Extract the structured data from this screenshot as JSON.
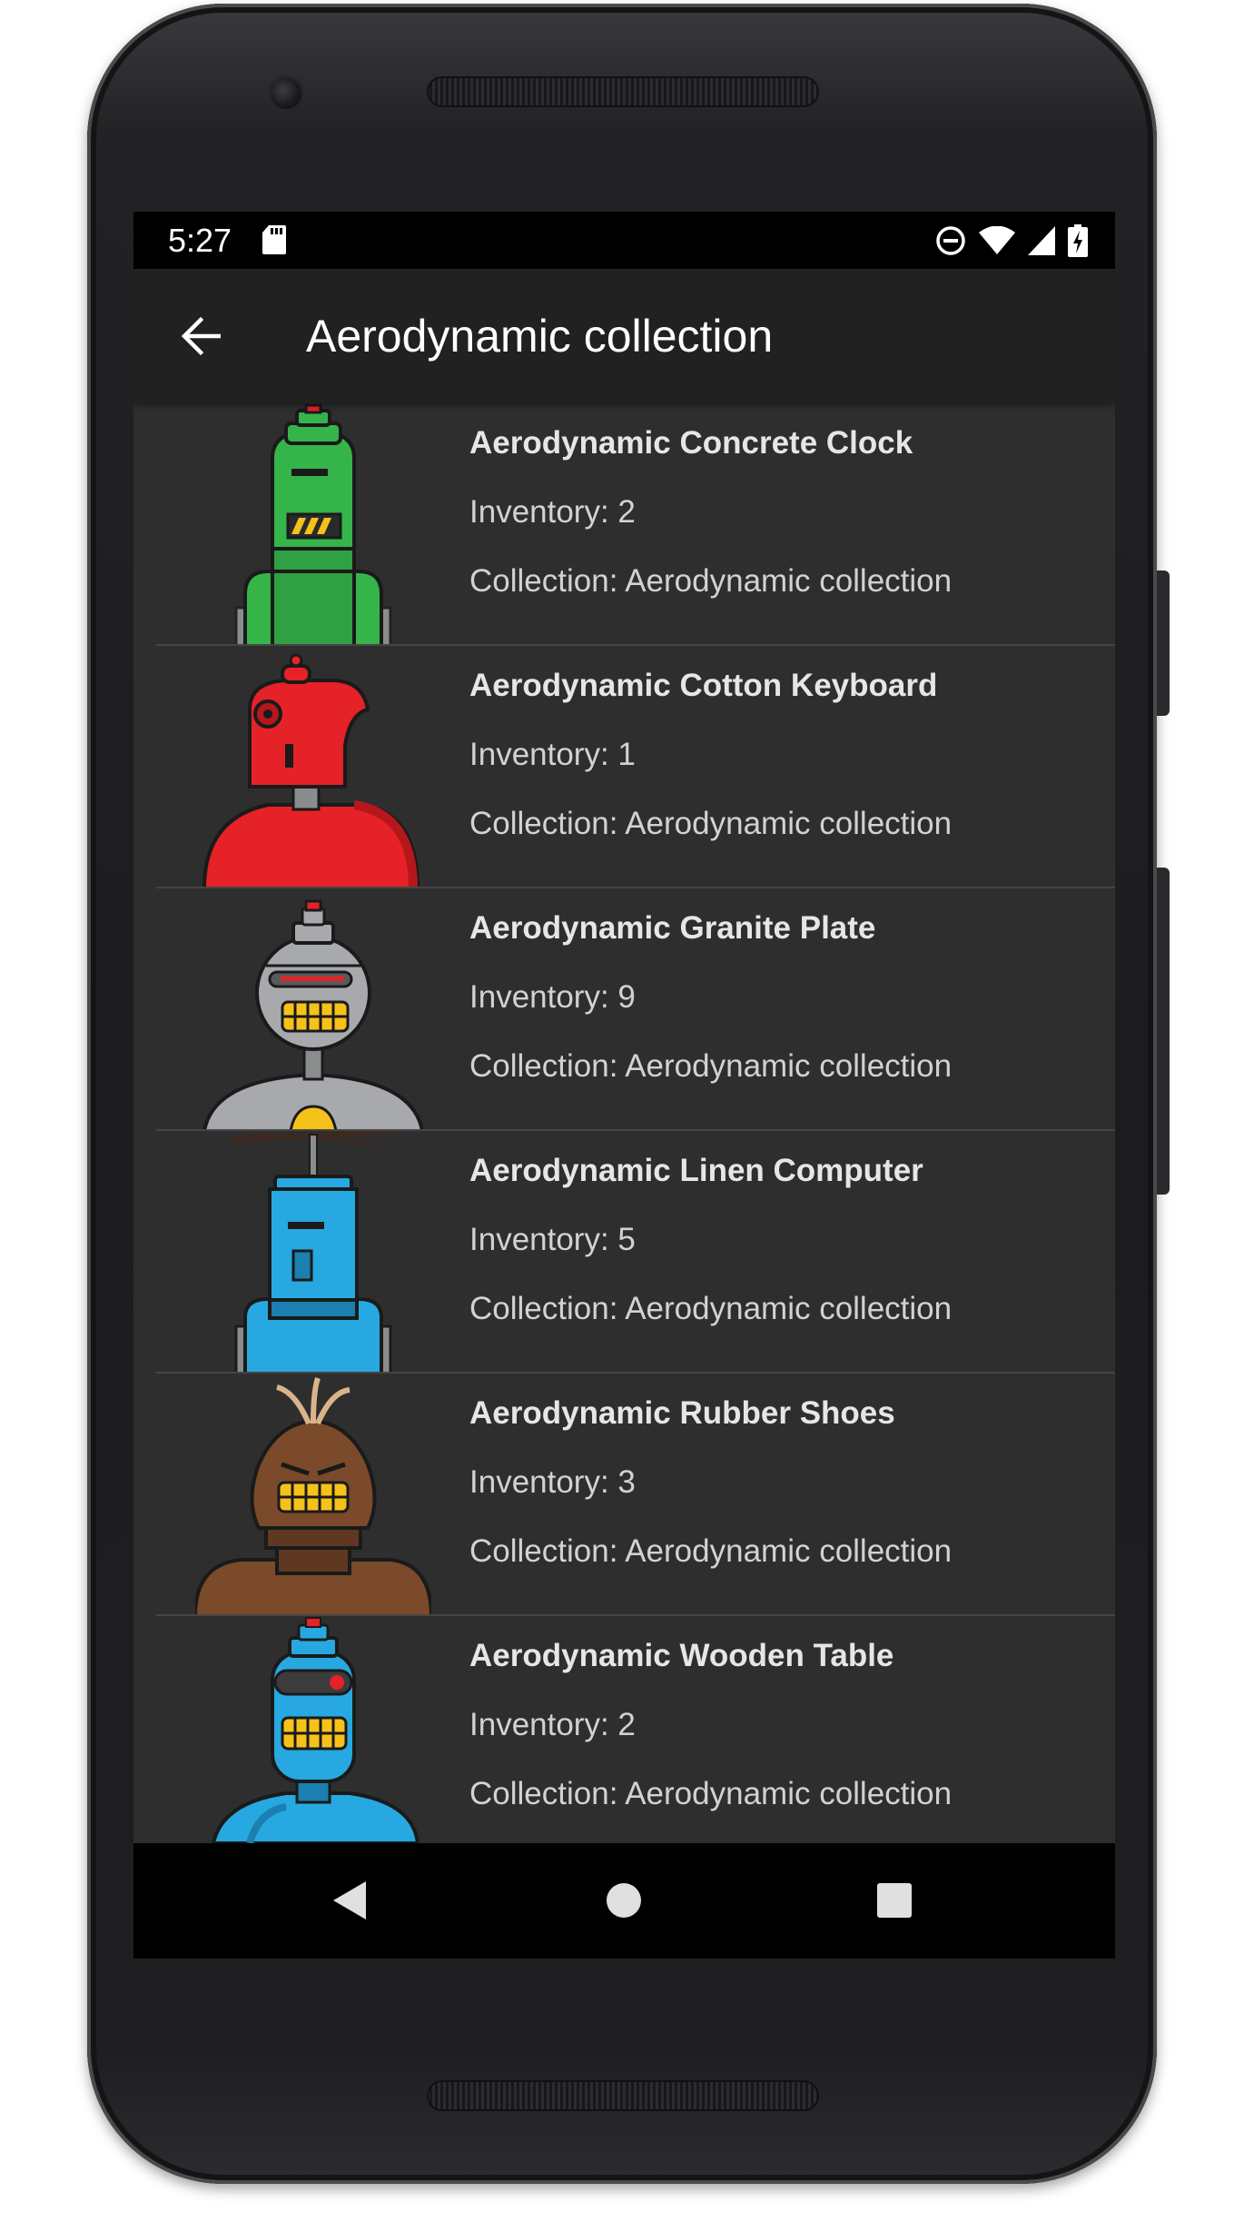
{
  "status_bar": {
    "time": "5:27",
    "left_icons": [
      "sd-card-icon"
    ],
    "right_icons": [
      "do-not-disturb-icon",
      "wifi-icon",
      "cell-signal-icon",
      "battery-charging-icon"
    ]
  },
  "app_bar": {
    "title": "Aerodynamic collection",
    "back_icon": "arrow-back-icon"
  },
  "products": [
    {
      "name": "Aerodynamic Concrete Clock",
      "inventory": "Inventory: 2",
      "collection": "Collection: Aerodynamic collection",
      "robot": "green"
    },
    {
      "name": "Aerodynamic Cotton Keyboard",
      "inventory": "Inventory: 1",
      "collection": "Collection: Aerodynamic collection",
      "robot": "red"
    },
    {
      "name": "Aerodynamic Granite Plate",
      "inventory": "Inventory: 9",
      "collection": "Collection: Aerodynamic collection",
      "robot": "gray"
    },
    {
      "name": "Aerodynamic Linen Computer",
      "inventory": "Inventory: 5",
      "collection": "Collection: Aerodynamic collection",
      "robot": "blue-propeller"
    },
    {
      "name": "Aerodynamic Rubber Shoes",
      "inventory": "Inventory: 3",
      "collection": "Collection: Aerodynamic collection",
      "robot": "brown"
    },
    {
      "name": "Aerodynamic Wooden Table",
      "inventory": "Inventory: 2",
      "collection": "Collection: Aerodynamic collection",
      "robot": "blue"
    }
  ],
  "nav_bar": {
    "icons": [
      "nav-back-icon",
      "nav-home-icon",
      "nav-recents-icon"
    ]
  },
  "colors": {
    "screen_bg": "#2e2e2f",
    "app_bar_bg": "#212121",
    "status_bar_bg": "#000000",
    "robot_green": "#35b44a",
    "robot_red": "#e52228",
    "robot_gray": "#a7a9ac",
    "robot_blue": "#27a8e0",
    "robot_brown": "#7b4a2a"
  }
}
